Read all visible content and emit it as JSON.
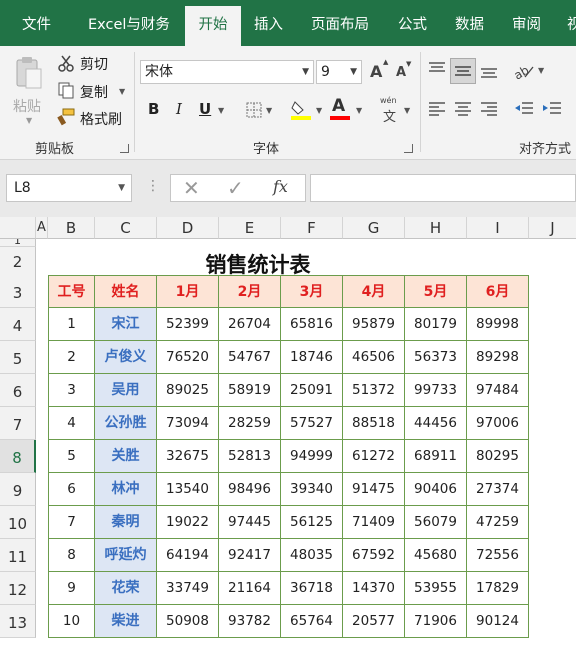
{
  "tabs": [
    "文件",
    "Excel与财务",
    "开始",
    "插入",
    "页面布局",
    "公式",
    "数据",
    "审阅",
    "视"
  ],
  "ribbon": {
    "clipboard": {
      "paste": "粘贴",
      "cut": "剪切",
      "copy": "复制",
      "format_painter": "格式刷",
      "group_label": "剪贴板"
    },
    "font": {
      "name": "宋体",
      "size": "9",
      "bold": "B",
      "italic": "I",
      "underline": "U",
      "font_color_glyph": "A",
      "wen": "wén",
      "wen_char": "文",
      "grow": "A",
      "shrink": "A",
      "group_label": "字体",
      "fill_color": "#ffff00",
      "font_color": "#ff0000"
    },
    "alignment": {
      "group_label": "对齐方式"
    }
  },
  "formula_bar": {
    "name_box": "L8",
    "fx": "fx",
    "value": ""
  },
  "columns": [
    "A",
    "B",
    "C",
    "D",
    "E",
    "F",
    "G",
    "H",
    "I",
    "J"
  ],
  "rows": [
    "1",
    "2",
    "3",
    "4",
    "5",
    "6",
    "7",
    "8",
    "9",
    "10",
    "11",
    "12",
    "13"
  ],
  "selected_row": "8",
  "sheet": {
    "title": "销售统计表",
    "headers": [
      "工号",
      "姓名",
      "1月",
      "2月",
      "3月",
      "4月",
      "5月",
      "6月"
    ],
    "data": [
      [
        "1",
        "宋江",
        "52399",
        "26704",
        "65816",
        "95879",
        "80179",
        "89998"
      ],
      [
        "2",
        "卢俊义",
        "76520",
        "54767",
        "18746",
        "46506",
        "56373",
        "89298"
      ],
      [
        "3",
        "吴用",
        "89025",
        "58919",
        "25091",
        "51372",
        "99733",
        "97484"
      ],
      [
        "4",
        "公孙胜",
        "73094",
        "28259",
        "57527",
        "88518",
        "44456",
        "97006"
      ],
      [
        "5",
        "关胜",
        "32675",
        "52813",
        "94999",
        "61272",
        "68911",
        "80295"
      ],
      [
        "6",
        "林冲",
        "13540",
        "98496",
        "39340",
        "91475",
        "90406",
        "27374"
      ],
      [
        "7",
        "秦明",
        "19022",
        "97445",
        "56125",
        "71409",
        "56079",
        "47259"
      ],
      [
        "8",
        "呼延灼",
        "64194",
        "92417",
        "48035",
        "67592",
        "45680",
        "72556"
      ],
      [
        "9",
        "花荣",
        "33749",
        "21164",
        "36718",
        "14370",
        "53955",
        "17829"
      ],
      [
        "10",
        "柴进",
        "50908",
        "93782",
        "65764",
        "20577",
        "71906",
        "90124"
      ]
    ]
  }
}
